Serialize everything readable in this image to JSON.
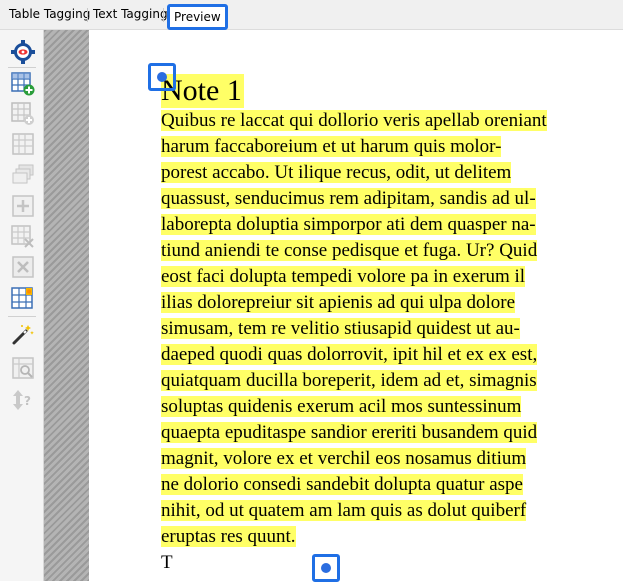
{
  "tabs": [
    {
      "label": "Table Tagging"
    },
    {
      "label": "Text Tagging"
    },
    {
      "label": "Preview",
      "active": true
    }
  ],
  "toolbar": {
    "tools": [
      {
        "icon": "eye-settings-icon",
        "enabled": true
      },
      {
        "icon": "insert-table-icon",
        "enabled": true
      },
      {
        "icon": "add-row-icon",
        "enabled": false
      },
      {
        "icon": "table-grid-icon",
        "enabled": false
      },
      {
        "icon": "stack-layers-icon",
        "enabled": false
      },
      {
        "icon": "merge-cells-icon",
        "enabled": false
      },
      {
        "icon": "delete-cells-icon",
        "enabled": false
      },
      {
        "icon": "clear-cells-icon",
        "enabled": false
      },
      {
        "icon": "highlight-cell-icon",
        "enabled": true
      },
      {
        "icon": "magic-wand-icon",
        "enabled": true
      },
      {
        "icon": "table-inspect-icon",
        "enabled": false
      },
      {
        "icon": "sort-help-icon",
        "enabled": false
      }
    ]
  },
  "document": {
    "heading": "Note 1",
    "paragraph_lines": [
      "Quibus re laccat qui dollorio veris apellab oreniant",
      "harum faccaboreium et ut harum quis molor-",
      "porest accabo. Ut ilique recus, odit, ut delitem",
      "quassust, senducimus rem adipitam, sandis ad ul-",
      "laborepta doluptia simporpor ati dem quasper na-",
      "tiund aniendi te conse pedisque et fuga. Ur? Quid",
      "eost faci dolupta tempedi volore pa in exerum il",
      "ilias dolorepreiur sit apienis ad qui ulpa dolore",
      "simusam, tem re velitio stiusapid quidest ut au-",
      "daeped quodi quas dolorrovit, ipit hil et ex ex est,",
      "quiatquam ducilla boreperit, idem ad et, simagnis",
      "soluptas quidenis exerum acil mos suntessinum",
      "quaepta epuditaspe sandior ereriti busandem quid",
      "magnit, volore ex et verchil eos nosamus ditium",
      "ne dolorio consedi sandebit dolupta quatur aspe",
      "nihit, od ut quatem am lam quis as dolut quiberf",
      "eruptas res quunt."
    ],
    "trailing_fragment": "T"
  },
  "colors": {
    "highlight": "#ffff66",
    "accent": "#1f6fe5",
    "marker_dot": "#2b6de0"
  }
}
